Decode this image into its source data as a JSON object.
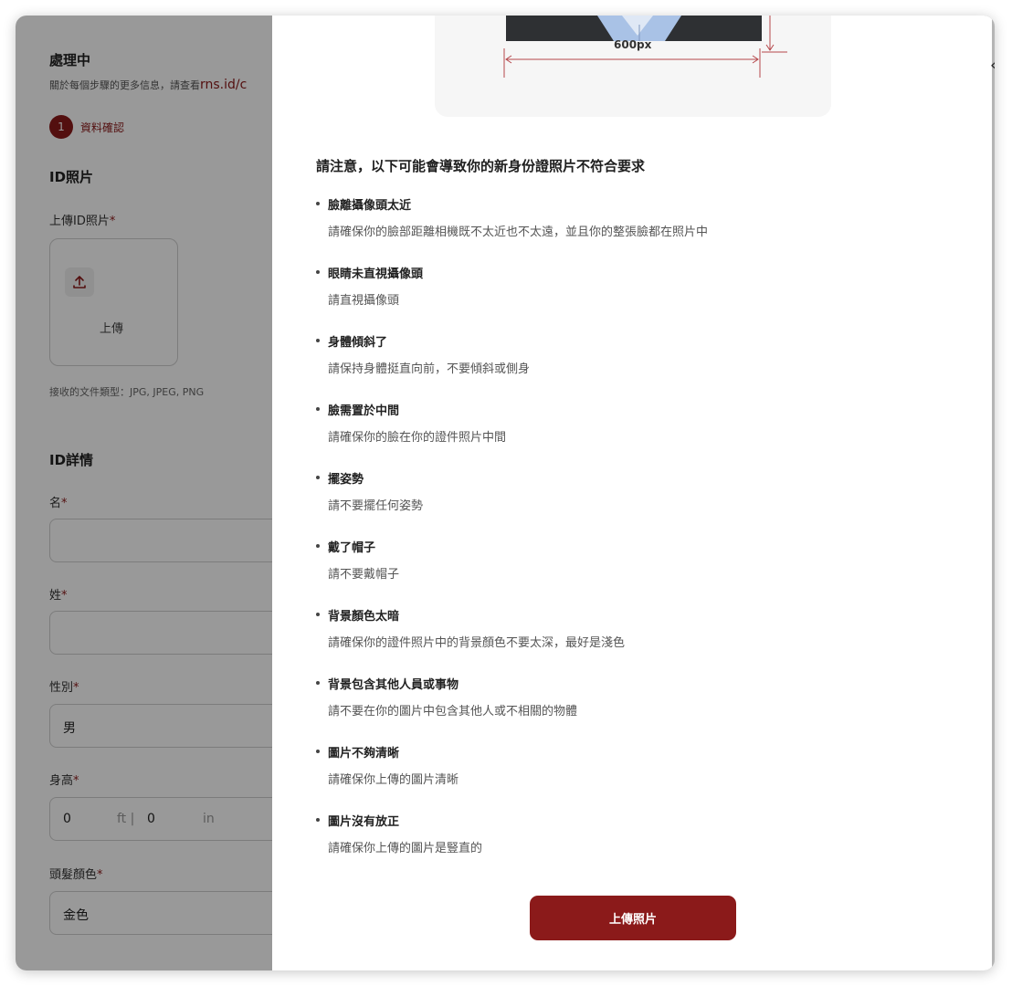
{
  "form": {
    "title": "處理中",
    "subtitle_prefix": "關於每個步驟的更多信息，請查看",
    "subtitle_link": "rns.id/c",
    "step": {
      "number": "1",
      "label": "資料確認"
    },
    "id_photo": {
      "section": "ID照片",
      "upload_label": "上傳ID照片",
      "upload_button": "上傳",
      "file_types": "接收的文件類型：JPG, JPEG, PNG"
    },
    "details": {
      "section": "ID詳情",
      "first_name_label": "名",
      "first_name_value": "",
      "last_name_label": "姓",
      "last_name_value": "",
      "gender_label": "性別",
      "gender_value": "男",
      "height_label": "身高",
      "height_ft_value": "0",
      "height_ft_unit": "ft |",
      "height_in_value": "0",
      "height_in_unit": "in",
      "hair_label": "頭髮顏色",
      "hair_value": "金色"
    },
    "required_mark": "*"
  },
  "modal": {
    "dimension_label": "600px",
    "notice": "請注意，以下可能會導致你的新身份證照片不符合要求",
    "issues": [
      {
        "title": "臉離攝像頭太近",
        "desc": "請確保你的臉部距離相機既不太近也不太遠，並且你的整張臉都在照片中"
      },
      {
        "title": "眼睛未直視攝像頭",
        "desc": "請直視攝像頭"
      },
      {
        "title": "身體傾斜了",
        "desc": "請保持身體挺直向前，不要傾斜或側身"
      },
      {
        "title": "臉需置於中間",
        "desc": "請確保你的臉在你的證件照片中間"
      },
      {
        "title": "擺姿勢",
        "desc": "請不要擺任何姿勢"
      },
      {
        "title": "戴了帽子",
        "desc": "請不要戴帽子"
      },
      {
        "title": "背景顏色太暗",
        "desc": "請確保你的證件照片中的背景顏色不要太深，最好是淺色"
      },
      {
        "title": "背景包含其他人員或事物",
        "desc": "請不要在你的圖片中包含其他人或不相關的物體"
      },
      {
        "title": "圖片不夠清晰",
        "desc": "請確保你上傳的圖片清晰"
      },
      {
        "title": "圖片沒有放正",
        "desc": "請確保你上傳的圖片是豎直的"
      }
    ],
    "upload_button": "上傳照片"
  },
  "colors": {
    "accent": "#8b1a1a",
    "overlay": "rgba(0,0,0,0.40)"
  },
  "icons": {
    "upload": "upload-icon",
    "close": "close-icon"
  }
}
